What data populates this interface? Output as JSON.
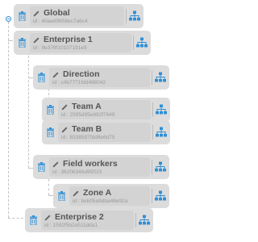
{
  "tree": {
    "nodes": [
      {
        "key": "global",
        "name": "Global",
        "id_label": "id : 40aed9658ec7a6c4",
        "expanded": true
      },
      {
        "key": "enterprise-1",
        "name": "Enterprise 1",
        "id_label": "id : 9e378f10107191e9",
        "expanded": true
      },
      {
        "key": "direction",
        "name": "Direction",
        "id_label": "id : c4b7771fdd488042",
        "expanded": true
      },
      {
        "key": "team-a",
        "name": "Team A",
        "id_label": "id : 2595d95e892f7649",
        "expanded": false
      },
      {
        "key": "team-b",
        "name": "Team B",
        "id_label": "id : 8338597fdd8e6d75",
        "expanded": false
      },
      {
        "key": "field-workers",
        "name": "Field workers",
        "id_label": "id : 36206346d95f1f3",
        "expanded": true
      },
      {
        "key": "zone-a",
        "name": "Zone A",
        "id_label": "id : beb05a9dba48e92a",
        "expanded": false
      },
      {
        "key": "enterprise-2",
        "name": "Enterprise 2",
        "id_label": "id : 1592f5b2a511dda1",
        "expanded": false
      }
    ]
  },
  "icons": {
    "delete": "trash-icon",
    "edit": "pencil-icon",
    "hierarchy": "org-chart-icon",
    "collapse": "minus-circle-icon"
  },
  "colors": {
    "accent": "#2f8fd6",
    "card": "#dcdcdc",
    "text": "#555555",
    "id_text": "#9a9a9a"
  }
}
